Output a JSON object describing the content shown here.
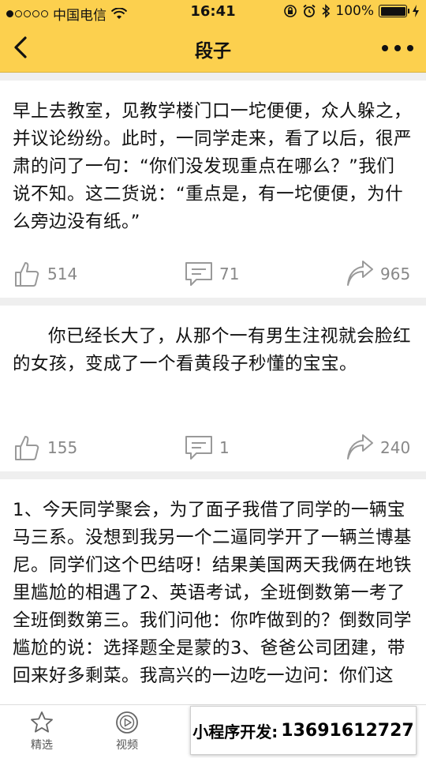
{
  "status_bar": {
    "carrier": "中国电信",
    "time": "16:41",
    "battery": "100%"
  },
  "header": {
    "title": "段子"
  },
  "posts": [
    {
      "text": "早上去教室，见教学楼门口一坨便便，众人躲之，并议论纷纷。此时，一同学走来，看了以后，很严肃的问了一句：“你们没发现重点在哪么？”我们说不知。这二货说：“重点是，有一坨便便，为什么旁边没有纸。”",
      "likes": "514",
      "comments": "71",
      "shares": "965"
    },
    {
      "text": "你已经长大了，从那个一有男生注视就会脸红的女孩，变成了一个看黄段子秒懂的宝宝。",
      "likes": "155",
      "comments": "1",
      "shares": "240"
    },
    {
      "text": "1、今天同学聚会，为了面子我借了同学的一辆宝马三系。没想到我另一个二逼同学开了一辆兰博基尼。同学们这个巴结呀！结果美国两天我俩在地铁里尴尬的相遇了2、英语考试，全班倒数第一考了全班倒数第三。我们问他：你咋做到的？倒数同学尴尬的说：选择题全是蒙的3、爸爸公司团建，带回来好多剩菜。我高兴的一边吃一边问：你们这"
    }
  ],
  "tabbar": {
    "tabs": [
      {
        "label": "精选"
      },
      {
        "label": "视频"
      }
    ]
  },
  "promo": {
    "label": "小程序开发:",
    "phone": "13691612727"
  },
  "colors": {
    "header_bg": "#fcd04e",
    "action_gray": "#888888"
  }
}
